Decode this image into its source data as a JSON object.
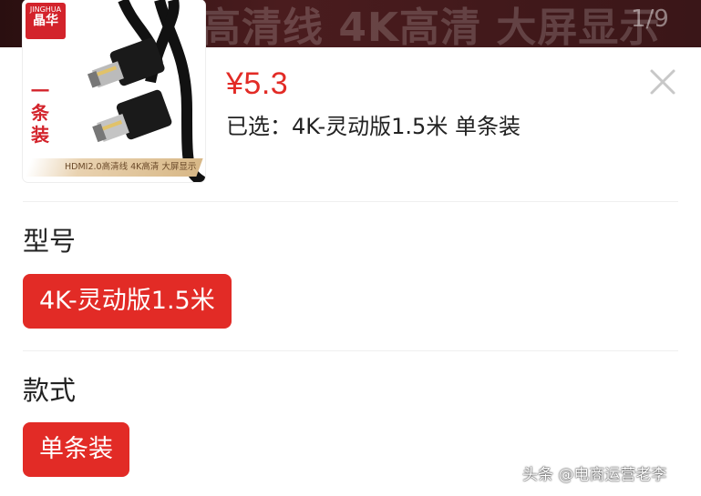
{
  "banner": {
    "text": "高清线 4K高清 大屏显示",
    "counter": "1/9"
  },
  "product": {
    "brand_small": "JINGHUA",
    "brand_big": "晶华",
    "thumb_tag": "一条装",
    "thumb_caption": "HDMI2.0高清线 4K高清 大屏显示",
    "price": "¥5.3",
    "selected": "已选：4K-灵动版1.5米 单条装"
  },
  "options": [
    {
      "title": "型号",
      "value": "4K-灵动版1.5米"
    },
    {
      "title": "款式",
      "value": "单条装"
    }
  ],
  "icons": {
    "close": "close-icon"
  },
  "watermark": "头条 @电商运营老李",
  "colors": {
    "accent": "#e22b26",
    "banner": "#3a1618"
  }
}
